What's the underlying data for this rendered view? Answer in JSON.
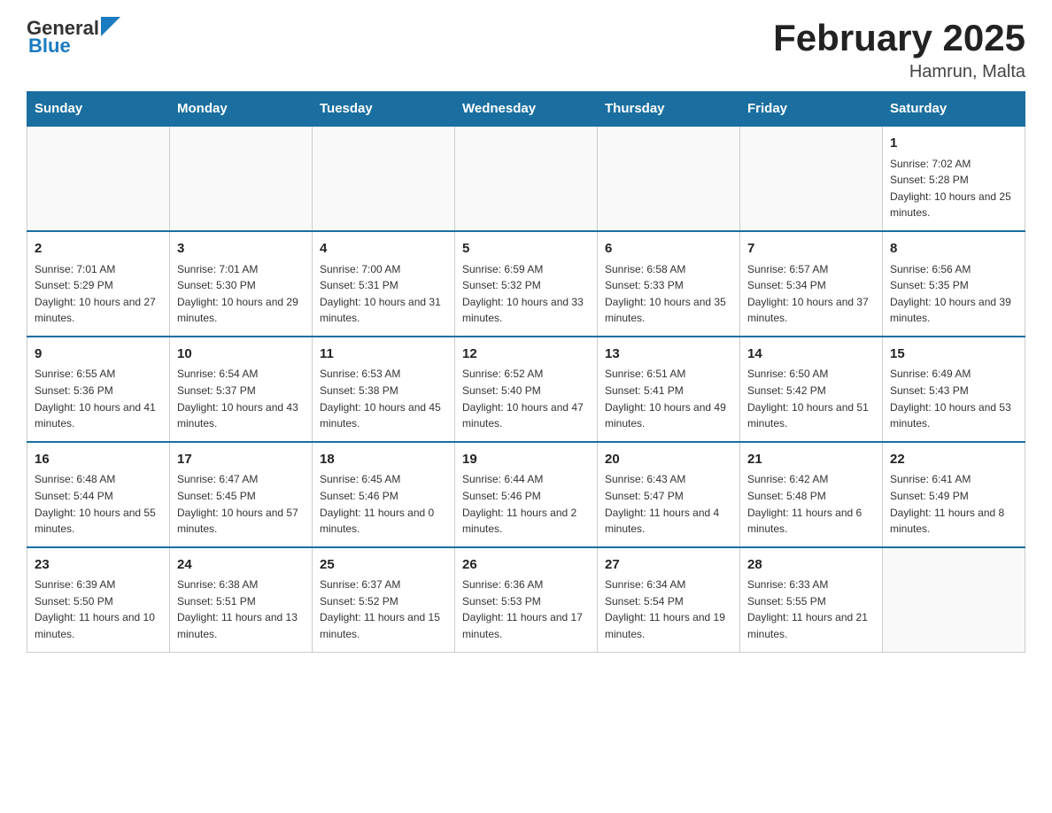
{
  "header": {
    "logo_general": "General",
    "logo_blue": "Blue",
    "title": "February 2025",
    "subtitle": "Hamrun, Malta"
  },
  "days_of_week": [
    "Sunday",
    "Monday",
    "Tuesday",
    "Wednesday",
    "Thursday",
    "Friday",
    "Saturday"
  ],
  "weeks": [
    [
      {
        "day": "",
        "info": ""
      },
      {
        "day": "",
        "info": ""
      },
      {
        "day": "",
        "info": ""
      },
      {
        "day": "",
        "info": ""
      },
      {
        "day": "",
        "info": ""
      },
      {
        "day": "",
        "info": ""
      },
      {
        "day": "1",
        "info": "Sunrise: 7:02 AM\nSunset: 5:28 PM\nDaylight: 10 hours and 25 minutes."
      }
    ],
    [
      {
        "day": "2",
        "info": "Sunrise: 7:01 AM\nSunset: 5:29 PM\nDaylight: 10 hours and 27 minutes."
      },
      {
        "day": "3",
        "info": "Sunrise: 7:01 AM\nSunset: 5:30 PM\nDaylight: 10 hours and 29 minutes."
      },
      {
        "day": "4",
        "info": "Sunrise: 7:00 AM\nSunset: 5:31 PM\nDaylight: 10 hours and 31 minutes."
      },
      {
        "day": "5",
        "info": "Sunrise: 6:59 AM\nSunset: 5:32 PM\nDaylight: 10 hours and 33 minutes."
      },
      {
        "day": "6",
        "info": "Sunrise: 6:58 AM\nSunset: 5:33 PM\nDaylight: 10 hours and 35 minutes."
      },
      {
        "day": "7",
        "info": "Sunrise: 6:57 AM\nSunset: 5:34 PM\nDaylight: 10 hours and 37 minutes."
      },
      {
        "day": "8",
        "info": "Sunrise: 6:56 AM\nSunset: 5:35 PM\nDaylight: 10 hours and 39 minutes."
      }
    ],
    [
      {
        "day": "9",
        "info": "Sunrise: 6:55 AM\nSunset: 5:36 PM\nDaylight: 10 hours and 41 minutes."
      },
      {
        "day": "10",
        "info": "Sunrise: 6:54 AM\nSunset: 5:37 PM\nDaylight: 10 hours and 43 minutes."
      },
      {
        "day": "11",
        "info": "Sunrise: 6:53 AM\nSunset: 5:38 PM\nDaylight: 10 hours and 45 minutes."
      },
      {
        "day": "12",
        "info": "Sunrise: 6:52 AM\nSunset: 5:40 PM\nDaylight: 10 hours and 47 minutes."
      },
      {
        "day": "13",
        "info": "Sunrise: 6:51 AM\nSunset: 5:41 PM\nDaylight: 10 hours and 49 minutes."
      },
      {
        "day": "14",
        "info": "Sunrise: 6:50 AM\nSunset: 5:42 PM\nDaylight: 10 hours and 51 minutes."
      },
      {
        "day": "15",
        "info": "Sunrise: 6:49 AM\nSunset: 5:43 PM\nDaylight: 10 hours and 53 minutes."
      }
    ],
    [
      {
        "day": "16",
        "info": "Sunrise: 6:48 AM\nSunset: 5:44 PM\nDaylight: 10 hours and 55 minutes."
      },
      {
        "day": "17",
        "info": "Sunrise: 6:47 AM\nSunset: 5:45 PM\nDaylight: 10 hours and 57 minutes."
      },
      {
        "day": "18",
        "info": "Sunrise: 6:45 AM\nSunset: 5:46 PM\nDaylight: 11 hours and 0 minutes."
      },
      {
        "day": "19",
        "info": "Sunrise: 6:44 AM\nSunset: 5:46 PM\nDaylight: 11 hours and 2 minutes."
      },
      {
        "day": "20",
        "info": "Sunrise: 6:43 AM\nSunset: 5:47 PM\nDaylight: 11 hours and 4 minutes."
      },
      {
        "day": "21",
        "info": "Sunrise: 6:42 AM\nSunset: 5:48 PM\nDaylight: 11 hours and 6 minutes."
      },
      {
        "day": "22",
        "info": "Sunrise: 6:41 AM\nSunset: 5:49 PM\nDaylight: 11 hours and 8 minutes."
      }
    ],
    [
      {
        "day": "23",
        "info": "Sunrise: 6:39 AM\nSunset: 5:50 PM\nDaylight: 11 hours and 10 minutes."
      },
      {
        "day": "24",
        "info": "Sunrise: 6:38 AM\nSunset: 5:51 PM\nDaylight: 11 hours and 13 minutes."
      },
      {
        "day": "25",
        "info": "Sunrise: 6:37 AM\nSunset: 5:52 PM\nDaylight: 11 hours and 15 minutes."
      },
      {
        "day": "26",
        "info": "Sunrise: 6:36 AM\nSunset: 5:53 PM\nDaylight: 11 hours and 17 minutes."
      },
      {
        "day": "27",
        "info": "Sunrise: 6:34 AM\nSunset: 5:54 PM\nDaylight: 11 hours and 19 minutes."
      },
      {
        "day": "28",
        "info": "Sunrise: 6:33 AM\nSunset: 5:55 PM\nDaylight: 11 hours and 21 minutes."
      },
      {
        "day": "",
        "info": ""
      }
    ]
  ]
}
